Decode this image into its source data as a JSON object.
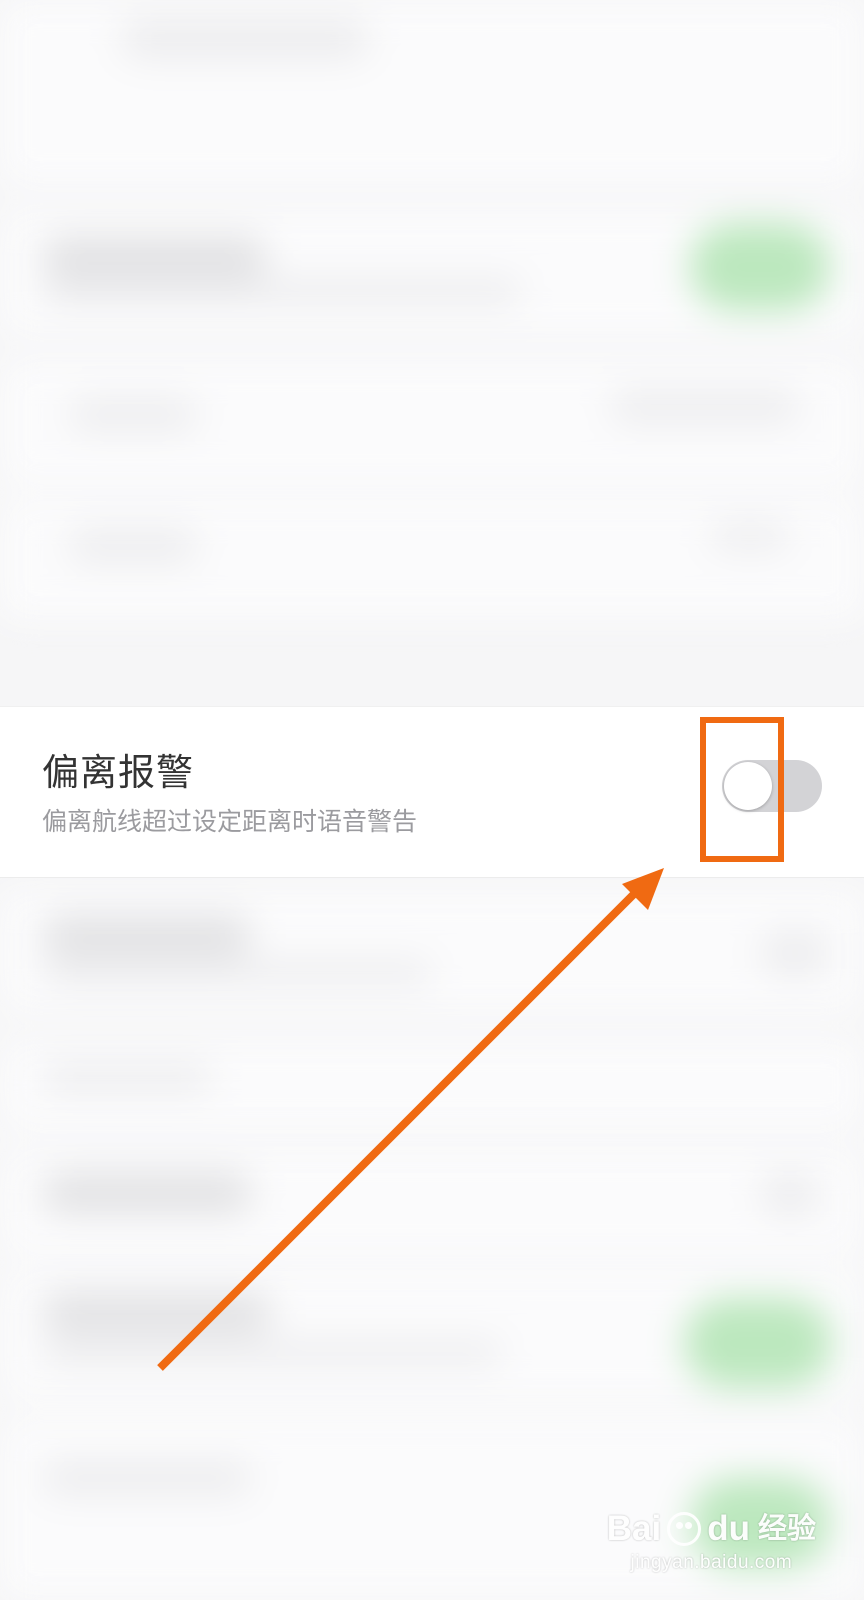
{
  "setting": {
    "title": "偏离报警",
    "subtitle": "偏离航线超过设定距离时语音警告",
    "toggle_state": "off",
    "toggle_track_color": "#d3d3d6"
  },
  "annotation": {
    "highlight_color": "#f06a12",
    "arrow_color": "#f06a12"
  },
  "watermark": {
    "brand_left": "Bai",
    "brand_right": "du",
    "brand_cn": "经验",
    "url": "jingyan.baidu.com"
  }
}
